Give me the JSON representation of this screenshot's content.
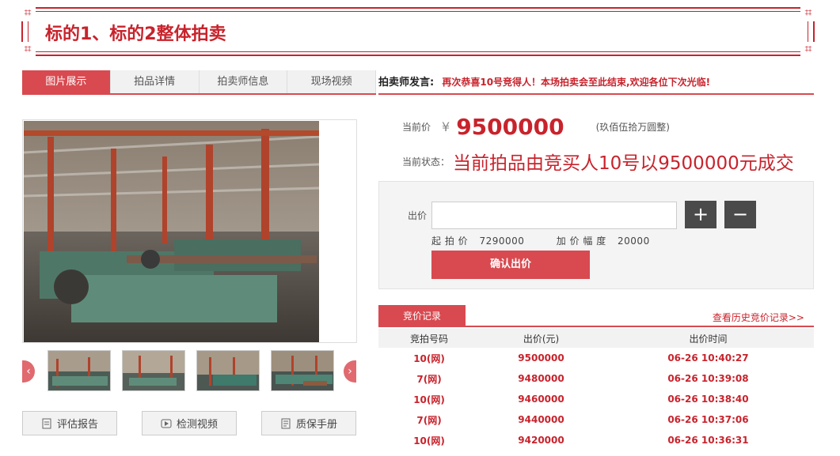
{
  "title": "标的1、标的2整体拍卖",
  "tabs": [
    "图片展示",
    "拍品详情",
    "拍卖师信息",
    "现场视频"
  ],
  "announcement": {
    "label": "拍卖师发言:",
    "message": "再次恭喜10号竞得人！本场拍卖会至此结束,欢迎各位下次光临!"
  },
  "price": {
    "label": "当前价",
    "currency": "¥",
    "value": "9500000",
    "chinese": "(玖佰伍拾万圆整)"
  },
  "status": {
    "label": "当前状态：",
    "text": "当前拍品由竞买人10号以9500000元成交"
  },
  "bid": {
    "label": "出价",
    "input_value": "",
    "plus": "+",
    "minus": "−",
    "start_label": "起 拍 价",
    "start_value": "7290000",
    "increment_label": "加 价 幅 度",
    "increment_value": "20000",
    "confirm": "确认出价"
  },
  "gallery": {
    "prev": "‹",
    "next": "›"
  },
  "buttons": [
    "评估报告",
    "检测视频",
    "质保手册"
  ],
  "records": {
    "tab": "竞价记录",
    "history_link": "查看历史竞价记录>>",
    "columns": [
      "竞拍号码",
      "出价(元)",
      "出价时间"
    ],
    "rows": [
      [
        "10(网)",
        "9500000",
        "06-26 10:40:27"
      ],
      [
        "7(网)",
        "9480000",
        "06-26 10:39:08"
      ],
      [
        "10(网)",
        "9460000",
        "06-26 10:38:40"
      ],
      [
        "7(网)",
        "9440000",
        "06-26 10:37:06"
      ],
      [
        "10(网)",
        "9420000",
        "06-26 10:36:31"
      ]
    ]
  },
  "colors": {
    "accent": "#c8232c",
    "tab_active": "#d84a50",
    "step_button": "#4a4a4a"
  }
}
